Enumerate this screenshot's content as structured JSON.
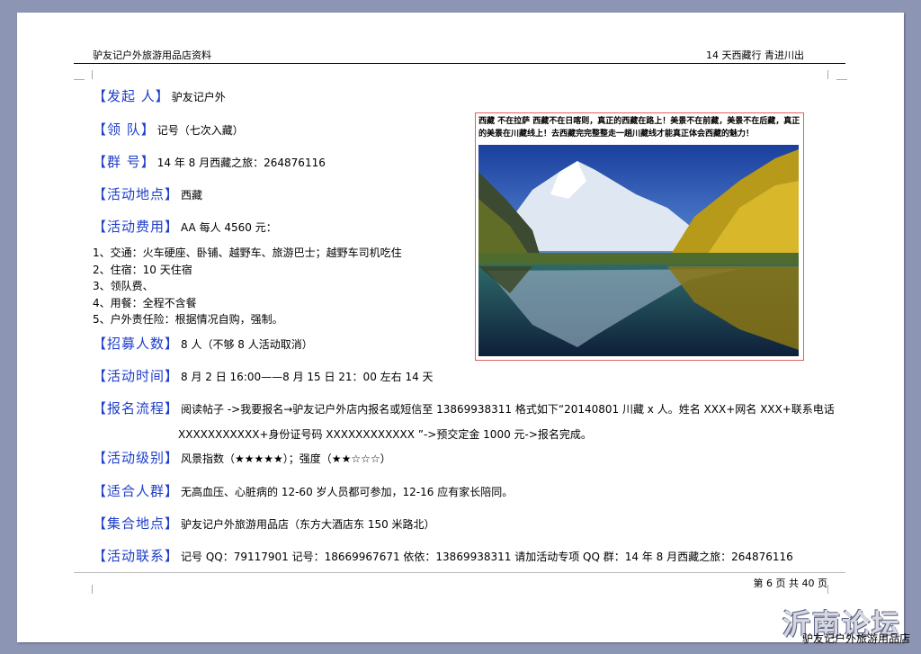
{
  "header": {
    "left": "驴友记户外旅游用品店资料",
    "right": "14 天西藏行  青进川出"
  },
  "rows": {
    "organizer": {
      "label": "【发起 人】",
      "value": "驴友记户外"
    },
    "leader": {
      "label": "【领  队】",
      "value": "记号（七次入藏）"
    },
    "group": {
      "label": "【群  号】",
      "value": "14 年 8 月西藏之旅：264876116"
    },
    "location": {
      "label": "【活动地点】",
      "value": "西藏"
    },
    "cost": {
      "label": "【活动费用】",
      "value": "AA 每人 4560 元："
    },
    "recruit": {
      "label": "【招募人数】",
      "value": "8 人（不够 8 人活动取消）"
    },
    "time": {
      "label": "【活动时间】",
      "value": "8 月 2 日 16:00——8 月 15 日  21：00 左右  14 天"
    },
    "process": {
      "label": "【报名流程】",
      "value": "阅读帖子 ->我要报名→驴友记户外店内报名或短信至 13869938311  格式如下“20140801 川藏 x 人。姓名 XXX+网名 XXX+联系电话"
    },
    "level": {
      "label": "【活动级别】",
      "value": "风景指数（★★★★★）；强度（★★☆☆☆）"
    },
    "suitable": {
      "label": "【适合人群】",
      "value": "无高血压、心脏病的 12-60 岁人员都可参加，12-16 应有家长陪同。"
    },
    "meeting": {
      "label": "【集合地点】",
      "value": "驴友记户外旅游用品店（东方大酒店东 150 米路北）"
    },
    "contact": {
      "label": "【活动联系】",
      "value": "记号  QQ：79117901  记号：18669967671    依依：13869938311      请加活动专项 QQ 群：14 年 8 月西藏之旅：264876116"
    }
  },
  "cost_items": [
    "1、交通：火车硬座、卧铺、越野车、旅游巴士；越野车司机吃住",
    "2、住宿：10 天住宿",
    "3、领队费、",
    "4、用餐：全程不含餐",
    "5、户外责任险：根据情况自购，强制。"
  ],
  "process_continued": "XXXXXXXXXXX+身份证号码 XXXXXXXXXXXX ”->预交定金 1000 元->报名完成。",
  "photo_caption": "西藏 不在拉萨 西藏不在日喀则，真正的西藏在路上！美景不在前藏，美景不在后藏，真正的美景在川藏线上！去西藏完完整整走一趟川藏线才能真正体会西藏的魅力！",
  "footer": "第 6 页 共 40 页",
  "watermark": "沂南论坛",
  "watermark_sub": "驴友记户外旅游用品店"
}
